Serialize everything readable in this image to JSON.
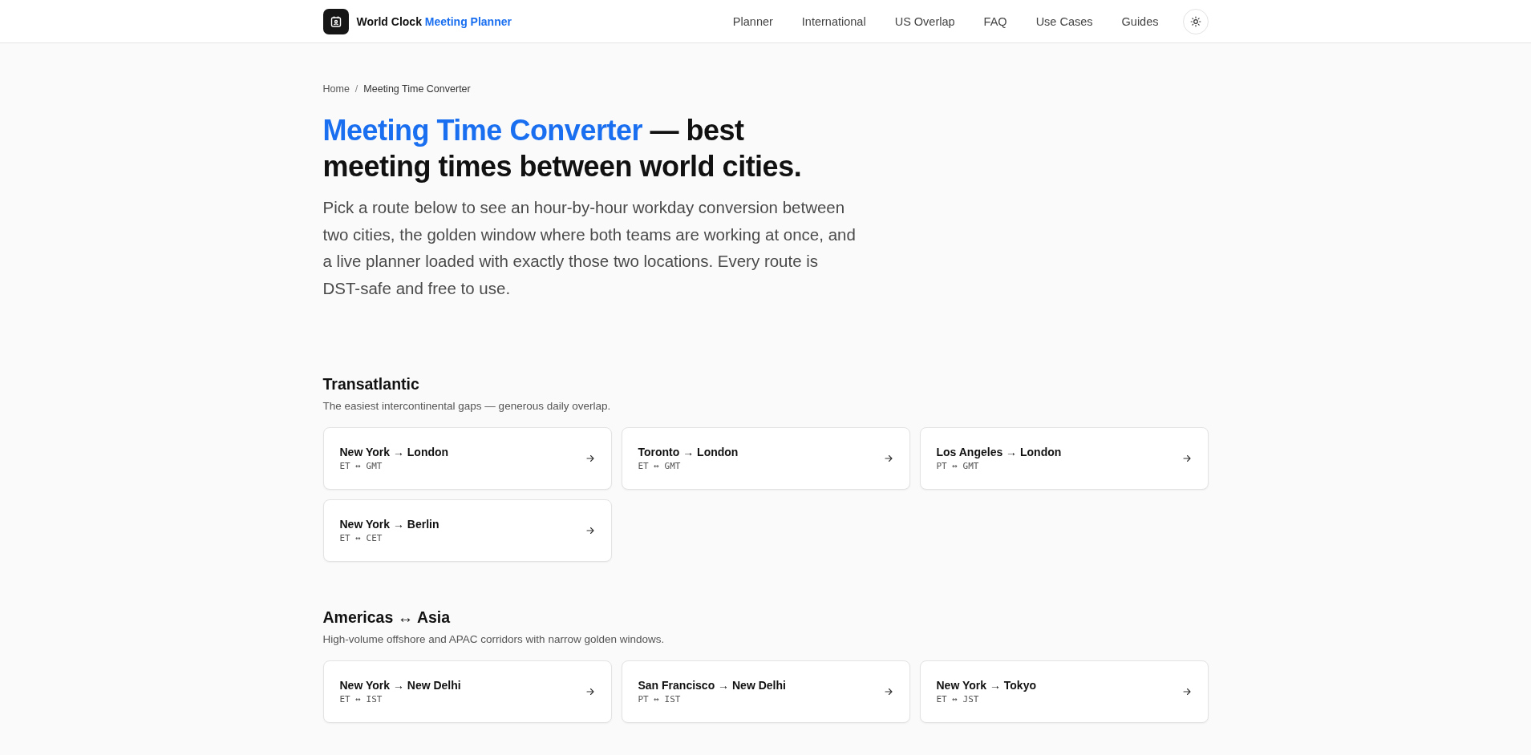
{
  "header": {
    "brand": {
      "text": "World Clock",
      "accent": "Meeting Planner"
    },
    "nav": [
      "Planner",
      "International",
      "US Overlap",
      "FAQ",
      "Use Cases",
      "Guides"
    ]
  },
  "breadcrumb": {
    "separator": "/",
    "items": [
      "Home",
      "Meeting Time Converter"
    ]
  },
  "hero": {
    "title_accent": "Meeting Time Converter",
    "title_rest": "— best meeting times between world cities.",
    "intro": "Pick a route below to see an hour-by-hour workday conversion between two cities, the golden window where both teams are working at once, and a live planner loaded with exactly those two locations. Every route is DST-safe and free to use."
  },
  "sections": [
    {
      "title": "Transatlantic",
      "subtitle": "The easiest intercontinental gaps — generous daily overlap.",
      "routes": [
        {
          "name": "New York → London",
          "zones": "ET ↔ GMT"
        },
        {
          "name": "Toronto → London",
          "zones": "ET ↔ GMT"
        },
        {
          "name": "Los Angeles → London",
          "zones": "PT ↔ GMT"
        },
        {
          "name": "New York → Berlin",
          "zones": "ET ↔ CET"
        }
      ]
    },
    {
      "title": "Americas ↔ Asia",
      "subtitle": "High-volume offshore and APAC corridors with narrow golden windows.",
      "routes": [
        {
          "name": "New York → New Delhi",
          "zones": "ET ↔ IST"
        },
        {
          "name": "San Francisco → New Delhi",
          "zones": "PT ↔ IST"
        },
        {
          "name": "New York → Tokyo",
          "zones": "ET ↔ JST"
        }
      ]
    }
  ]
}
